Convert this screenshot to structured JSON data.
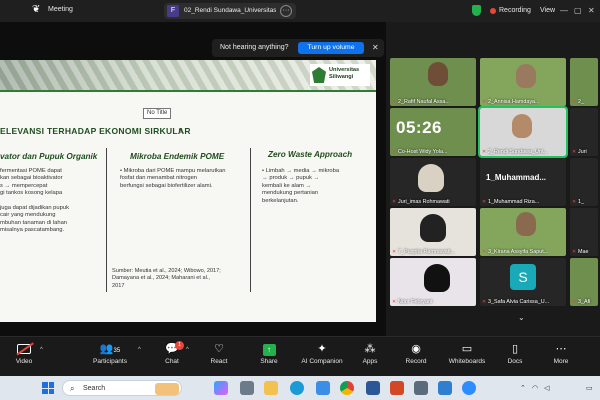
{
  "topbar": {
    "app_name": "Meeting",
    "tab_initial": "F",
    "tab_name": "02_Rendi Sundawa_Universitas Sil",
    "recording_label": "Recording",
    "view_label": "View"
  },
  "notification": {
    "text": "Not hearing anything?",
    "button": "Turn up volume"
  },
  "slide": {
    "logo_text_1": "Universitas",
    "logo_text_2": "Siliwangi",
    "no_title": "No Title",
    "title": "ELEVANSI TERHADAP EKONOMI SIRKULAR",
    "col1_heading": "vator dan Pupuk Organik",
    "col1_lines": [
      "fermentasi POME dapat",
      "kan sebagai bioaktivator",
      "s → mempercepat",
      "gi tankos kosong kelapa",
      "",
      "juga dapat dijadikan pupuk",
      "cair yang mendukung",
      "mbuhan tanaman di lahan",
      "misalnya pascatambang."
    ],
    "col2_heading": "Mikroba Endemik POME",
    "col2_lines": [
      "• Mikroba dari POME mampu melarutkan",
      "  fosfat dan menambat nitrogen",
      "  berfungsi sebagai biofertilizer alami."
    ],
    "col3_heading": "Zero Waste Approach",
    "col3_lines": [
      "• Limbah → media → mikroba",
      "  → produk → pupuk →",
      "  kembali ke alam →",
      "  mendukung pertanian",
      "  berkelanjutan."
    ],
    "source_lines": [
      "Sumber: Meutia et al., 2024; Wibowo, 2017;",
      "Damayana et al., 2024; Maharani et al.,",
      "2017"
    ]
  },
  "gallery": {
    "tiles": [
      {
        "name": "2_Rafif Naufal Assa..."
      },
      {
        "name": "2_Annisa Hamdaya..."
      },
      {
        "name": "2_"
      },
      {
        "name": "Co-Host Widy Yola..."
      },
      {
        "name": "2_Rendi Sundawa_Uni..."
      },
      {
        "name": "Juri"
      },
      {
        "name": "Juri_imas Rohmawati"
      },
      {
        "name": "1_Muhammad Riza..."
      },
      {
        "name": "1_"
      },
      {
        "name": "7_Puspita Ramnawati..."
      },
      {
        "name": "3_Kirana Assyifa Saput..."
      },
      {
        "name": "Mae"
      },
      {
        "name": "Noor Febryani"
      },
      {
        "name": "3_Safa Alvia Carissa_U..."
      },
      {
        "name": "3_Afi"
      }
    ],
    "clock": "05:26",
    "big_name": "1_Muhammad...",
    "avatar_letter": "S"
  },
  "toolbar": {
    "video": "Video",
    "participants": "Participants",
    "participants_count": "35",
    "chat": "Chat",
    "chat_badge": "1",
    "react": "React",
    "share": "Share",
    "ai_companion": "AI Companion",
    "apps": "Apps",
    "record": "Record",
    "whiteboards": "Whiteboards",
    "docs": "Docs",
    "more": "More"
  },
  "taskbar": {
    "search_placeholder": "Search"
  }
}
